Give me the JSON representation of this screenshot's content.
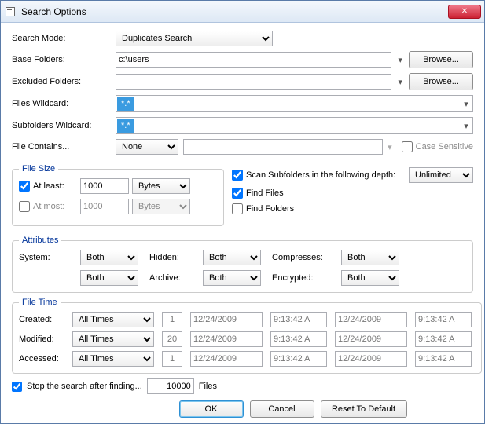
{
  "title": "Search Options",
  "labels": {
    "search_mode": "Search Mode:",
    "base_folders": "Base Folders:",
    "excluded_folders": "Excluded Folders:",
    "files_wildcard": "Files Wildcard:",
    "subfolders_wildcard": "Subfolders Wildcard:",
    "file_contains": "File Contains...",
    "case_sensitive": "Case Sensitive",
    "at_least": "At least:",
    "at_most": "At most:",
    "scan_subfolders": "Scan Subfolders in the following depth:",
    "find_files": "Find Files",
    "find_folders": "Find Folders",
    "system": "System:",
    "hidden": "Hidden:",
    "compresses": "Compresses:",
    "archive": "Archive:",
    "encrypted": "Encrypted:",
    "created": "Created:",
    "modified": "Modified:",
    "accessed": "Accessed:",
    "stop_after": "Stop the search after finding...",
    "files_suffix": "Files"
  },
  "groups": {
    "file_size": "File Size",
    "attributes": "Attributes",
    "file_time": "File Time"
  },
  "values": {
    "search_mode": "Duplicates Search",
    "base_folders": "c:\\users",
    "excluded_folders": "",
    "files_wildcard": "*.*",
    "subfolders_wildcard": "*.*",
    "file_contains_mode": "None",
    "file_contains_text": "",
    "at_least": "1000",
    "at_least_unit": "Bytes",
    "at_most": "1000",
    "at_most_unit": "Bytes",
    "depth": "Unlimited",
    "attr_system": "Both",
    "attr_hidden": "Both",
    "attr_compresses": "Both",
    "attr_readonly": "Both",
    "attr_archive": "Both",
    "attr_encrypted": "Both",
    "ft_mode": "All Times",
    "ft_created_n": "1",
    "ft_modified_n": "20",
    "ft_accessed_n": "1",
    "ft_date": "12/24/2009",
    "ft_time": "9:13:42 A",
    "stop_after": "10000"
  },
  "buttons": {
    "browse": "Browse...",
    "ok": "OK",
    "cancel": "Cancel",
    "reset": "Reset To Default"
  },
  "checkboxes": {
    "case_sensitive": false,
    "at_least": true,
    "at_most": false,
    "scan_subfolders": true,
    "find_files": true,
    "find_folders": false,
    "stop_after": true
  }
}
